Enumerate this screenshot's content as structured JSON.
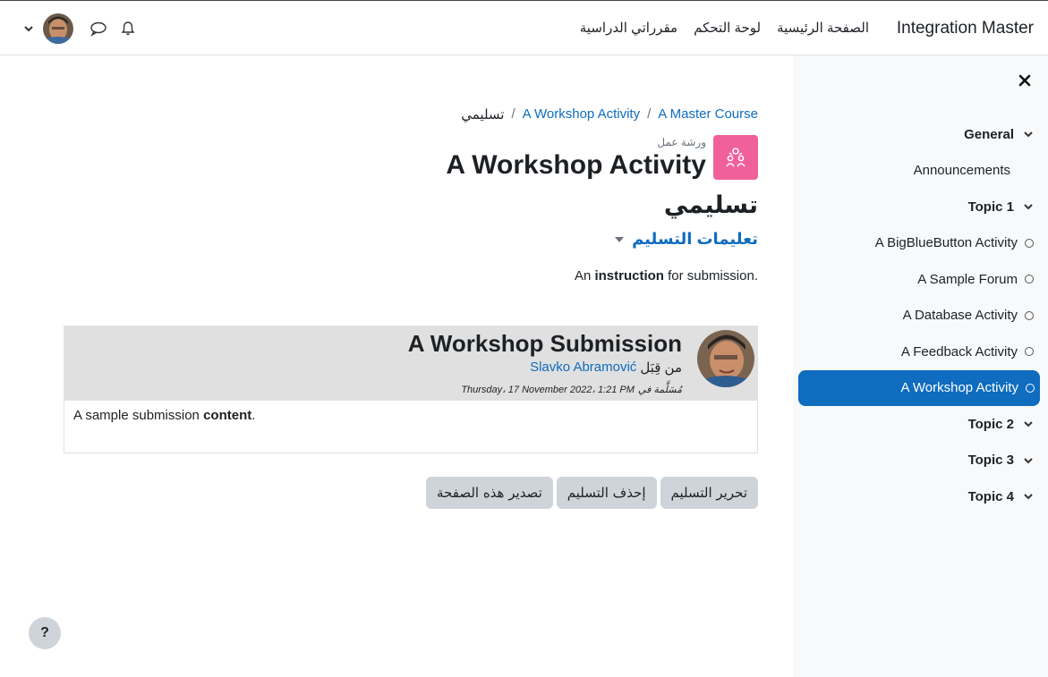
{
  "navbar": {
    "brand": "Integration Master",
    "links": [
      "الصفحة الرئيسية",
      "لوحة التحكم",
      "مقرراتي الدراسية"
    ]
  },
  "breadcrumb": {
    "course": "A Master Course",
    "activity": "A Workshop Activity",
    "current": "تسليمي",
    "separator": "/"
  },
  "header": {
    "module_type": "ورشة عمل",
    "title": "A Workshop Activity",
    "module_color": "#f0619c"
  },
  "page": {
    "subtitle": "تسليمي",
    "instructions_toggle": "تعليمات التسليم",
    "instruction_prefix": "An ",
    "instruction_bold": "instruction",
    "instruction_suffix": " for submission."
  },
  "submission": {
    "title": "A Workshop Submission",
    "by_label": "من قِبَل",
    "author": "Slavko Abramović",
    "submitted_label": "مُسَلَّمة في",
    "date": "Thursday، 17 November 2022، 1:21 PM",
    "content_prefix": "A sample submission ",
    "content_bold": "content",
    "content_suffix": "."
  },
  "actions": {
    "edit": "تحرير التسليم",
    "delete": "إحذف التسليم",
    "export": "تصدير هذه الصفحة"
  },
  "drawer": {
    "items": [
      {
        "type": "section",
        "label": "General"
      },
      {
        "type": "plain",
        "label": "Announcements"
      },
      {
        "type": "section",
        "label": "Topic 1"
      },
      {
        "type": "activity",
        "label": "A BigBlueButton Activity"
      },
      {
        "type": "activity",
        "label": "A Sample Forum"
      },
      {
        "type": "activity",
        "label": "A Database Activity"
      },
      {
        "type": "activity",
        "label": "A Feedback Activity"
      },
      {
        "type": "activity-active",
        "label": "A Workshop Activity"
      },
      {
        "type": "section",
        "label": "Topic 2"
      },
      {
        "type": "section",
        "label": "Topic 3"
      },
      {
        "type": "section",
        "label": "Topic 4"
      }
    ]
  },
  "help": {
    "label": "?"
  },
  "colors": {
    "accent": "#0f6cbf",
    "drawer_bg": "#f8f9fa",
    "button_bg": "#ced4da"
  }
}
